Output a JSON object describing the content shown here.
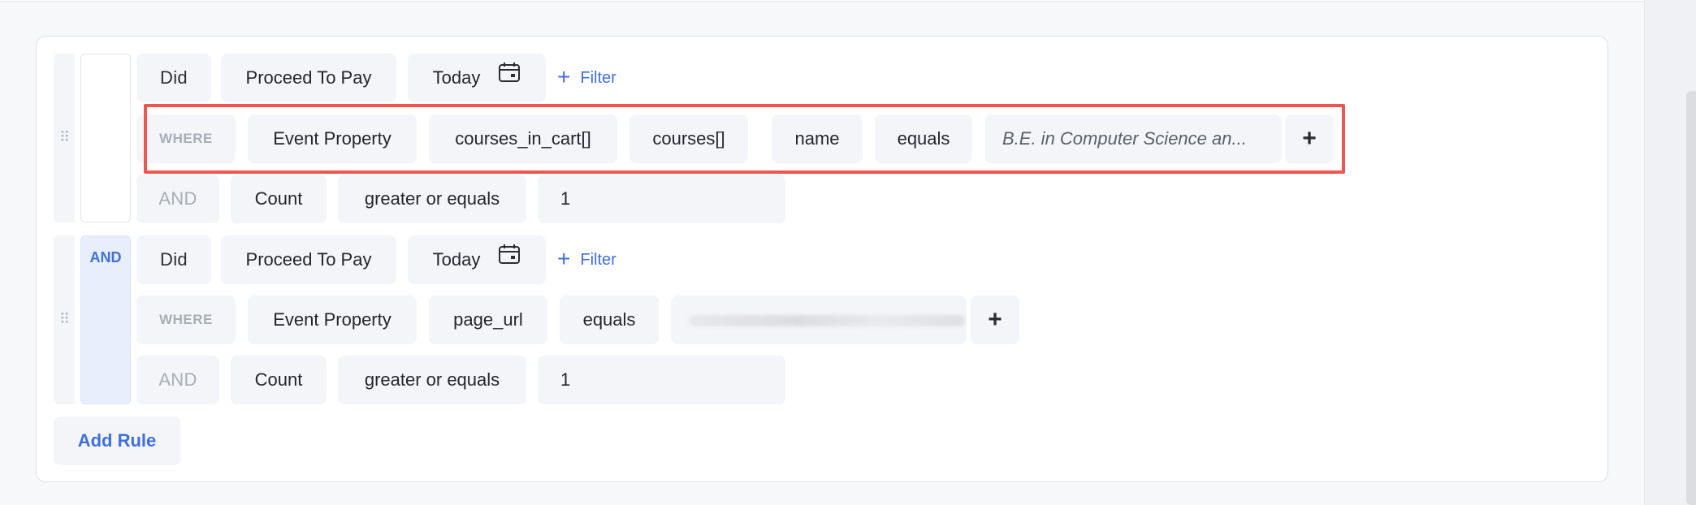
{
  "rule1": {
    "did_label": "Did",
    "event": "Proceed To Pay",
    "date": "Today",
    "date_icon": "calendar-icon",
    "filter_label": "Filter",
    "where_label": "WHERE",
    "property_type": "Event Property",
    "property_path": [
      "courses_in_cart[]",
      "courses[]",
      "name"
    ],
    "operator": "equals",
    "value": "B.E. in Computer Science an...",
    "add_value_label": "+",
    "and_label": "AND",
    "count_label": "Count",
    "count_operator": "greater or equals",
    "count_value": "1"
  },
  "connector": {
    "and_label": "AND"
  },
  "rule2": {
    "did_label": "Did",
    "event": "Proceed To Pay",
    "date": "Today",
    "date_icon": "calendar-icon",
    "filter_label": "Filter",
    "where_label": "WHERE",
    "property_type": "Event Property",
    "property": "page_url",
    "operator": "equals",
    "value": "",
    "add_value_label": "+",
    "and_label": "AND",
    "count_label": "Count",
    "count_operator": "greater or equals",
    "count_value": "1"
  },
  "add_rule_label": "Add Rule",
  "colors": {
    "accent": "#3f6fe0",
    "highlight": "#f0564f",
    "chip_bg": "#f4f5f8"
  }
}
